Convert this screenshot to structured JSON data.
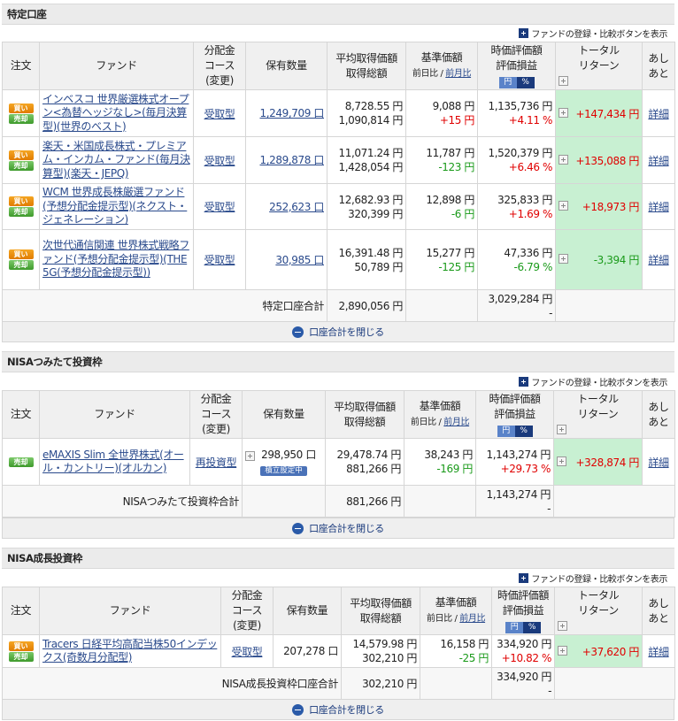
{
  "common": {
    "toolbar_label": "ファンドの登録・比較ボタンを表示",
    "headers": {
      "order": "注文",
      "fund": "ファンド",
      "course1": "分配金",
      "course2": "コース",
      "course3": "(変更)",
      "holdings": "保有数量",
      "avg1": "平均取得価額",
      "avg2": "取得総額",
      "nav1": "基準価額",
      "nav_sub1": "前日比",
      "nav_sub_sep": " / ",
      "nav_sub2": "前月比",
      "val1": "時価評価額",
      "val2": "評価損益",
      "yen": "円",
      "pct": "%",
      "tr1": "トータル",
      "tr2": "リターン",
      "ashi1": "あし",
      "ashi2": "あと"
    },
    "buy": "買い",
    "sell": "売却",
    "details": "詳細",
    "close": "口座合計を閉じる",
    "dash": "-"
  },
  "sections": [
    {
      "title": "特定口座",
      "rows": [
        {
          "name": "インベスコ 世界厳選株式オープン<為替ヘッジなし>(毎月決算型)(世界のベスト)",
          "course": "受取型",
          "qty": "1,249,709 口",
          "avg": "8,728.55 円",
          "total": "1,090,814 円",
          "nav": "9,088 円",
          "change": "+15 円",
          "value": "1,135,736 円",
          "gain": "+4.11 %",
          "tr": "+147,434 円"
        },
        {
          "name": "楽天・米国成長株式・プレミアム・インカム・ファンド(毎月決算型)(楽天・JEPQ)",
          "course": "受取型",
          "qty": "1,289,878 口",
          "avg": "11,071.24 円",
          "total": "1,428,054 円",
          "nav": "11,787 円",
          "change": "-123 円",
          "value": "1,520,379 円",
          "gain": "+6.46 %",
          "tr": "+135,088 円"
        },
        {
          "name": "WCM 世界成長株厳選ファンド(予想分配金提示型)(ネクスト・ジェネレーション)",
          "course": "受取型",
          "qty": "252,623 口",
          "avg": "12,682.93 円",
          "total": "320,399 円",
          "nav": "12,898 円",
          "change": "-6 円",
          "value": "325,833 円",
          "gain": "+1.69 %",
          "tr": "+18,973 円"
        },
        {
          "name": "次世代通信関連 世界株式戦略ファンド(予想分配金提示型)(THE 5G(予想分配金提示型))",
          "course": "受取型",
          "qty": "30,985 口",
          "avg": "16,391.48 円",
          "total": "50,789 円",
          "nav": "15,277 円",
          "change": "-125 円",
          "value": "47,336 円",
          "gain": "-6.79 %",
          "tr": "-3,394 円"
        }
      ],
      "subtotal_label": "特定口座合計",
      "subtotal_total": "2,890,056 円",
      "subtotal_value": "3,029,284 円"
    },
    {
      "title": "NISAつみたて投資枠",
      "rows": [
        {
          "name": "eMAXIS Slim 全世界株式(オール・カントリー)(オルカン)",
          "course": "再投資型",
          "qty": "298,950 口",
          "badge": "積立設定中",
          "avg": "29,478.74 円",
          "total": "881,266 円",
          "nav": "38,243 円",
          "change": "-169 円",
          "value": "1,143,274 円",
          "gain": "+29.73 %",
          "tr": "+328,874 円"
        }
      ],
      "subtotal_label": "NISAつみたて投資枠合計",
      "subtotal_total": "881,266 円",
      "subtotal_value": "1,143,274 円"
    },
    {
      "title": "NISA成長投資枠",
      "rows": [
        {
          "name": "Tracers 日経平均高配当株50インデックス(奇数月分配型)",
          "course": "受取型",
          "qty": "207,278 口",
          "avg": "14,579.98 円",
          "total": "302,210 円",
          "nav": "16,158 円",
          "change": "-25 円",
          "value": "334,920 円",
          "gain": "+10.82 %",
          "tr": "+37,620 円"
        }
      ],
      "subtotal_label": "NISA成長投資枠口座合計",
      "subtotal_total": "302,210 円",
      "subtotal_value": "334,920 円"
    }
  ]
}
